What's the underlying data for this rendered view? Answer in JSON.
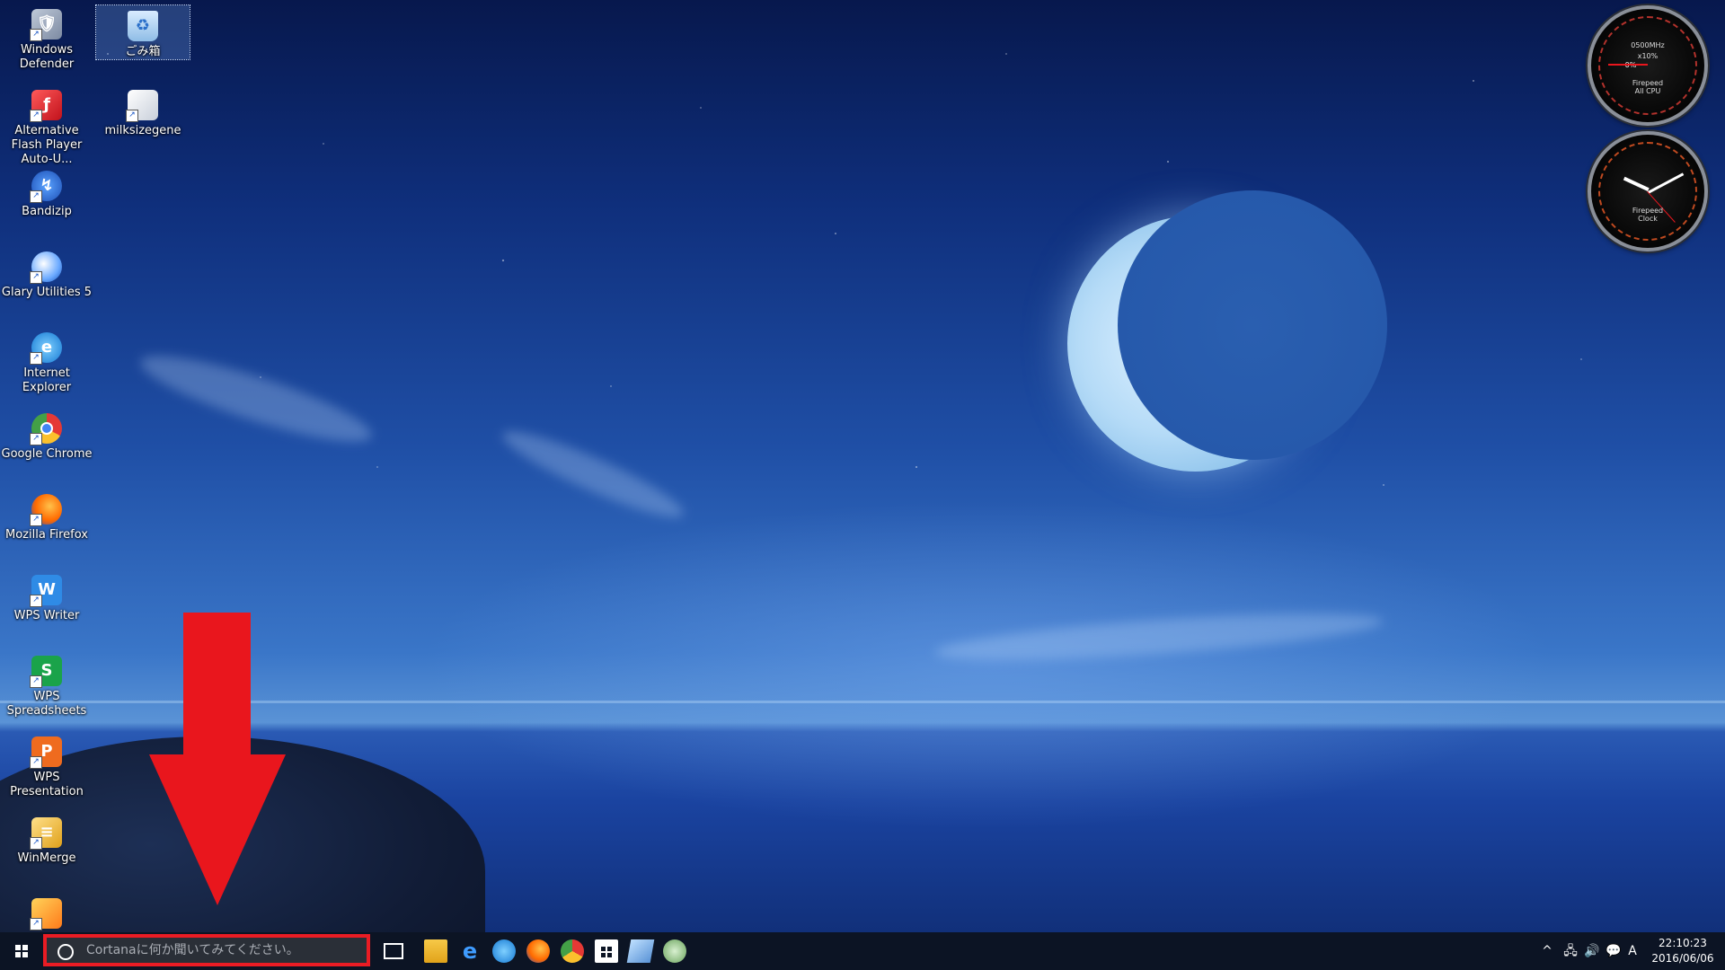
{
  "desktop": {
    "icons": [
      {
        "label": "Windows Defender",
        "icon": "windows-defender-icon"
      },
      {
        "label": "Alternative Flash Player Auto-U...",
        "icon": "flash-player-icon"
      },
      {
        "label": "Bandizip",
        "icon": "bandizip-icon"
      },
      {
        "label": "Glary Utilities 5",
        "icon": "glary-utilities-icon"
      },
      {
        "label": "Internet Explorer",
        "icon": "internet-explorer-icon"
      },
      {
        "label": "Google Chrome",
        "icon": "chrome-icon"
      },
      {
        "label": "Mozilla Firefox",
        "icon": "firefox-icon"
      },
      {
        "label": "WPS Writer",
        "icon": "wps-writer-icon"
      },
      {
        "label": "WPS Spreadsheets",
        "icon": "wps-spreadsheets-icon"
      },
      {
        "label": "WPS Presentation",
        "icon": "wps-presentation-icon"
      },
      {
        "label": "WinMerge",
        "icon": "winmerge-icon"
      },
      {
        "label": "ごみ箱",
        "icon": "recycle-bin-icon"
      },
      {
        "label": "milksizegene",
        "icon": "milksizegene-icon"
      }
    ]
  },
  "gadgets": {
    "cpu": {
      "speed": "0500MHz",
      "percent": "x10%",
      "needle_label": "0%",
      "brand": "Firepeed",
      "caption": "All CPU"
    },
    "clock": {
      "brand": "Firepeed",
      "caption": "Clock"
    }
  },
  "taskbar": {
    "search_placeholder": "Cortanaに何か聞いてみてください。",
    "ime_indicator": "A",
    "time": "22:10:23",
    "date": "2016/06/06"
  },
  "colors": {
    "annotation": "#e9161d",
    "taskbar": "#0c1424"
  }
}
